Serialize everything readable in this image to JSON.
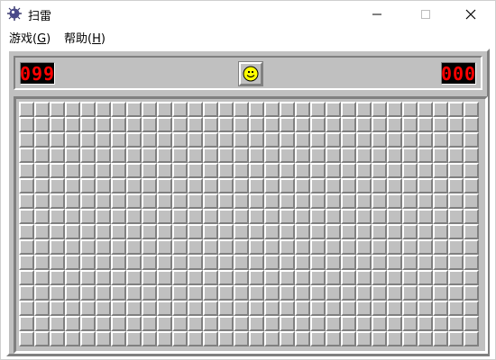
{
  "window": {
    "title": "扫雷",
    "app_icon": "minesweeper-mine-icon",
    "controls": {
      "minimize_icon": "minimize-icon",
      "maximize_icon": "maximize-icon",
      "close_icon": "close-icon"
    }
  },
  "menu": {
    "items": [
      {
        "label": "游戏(",
        "accelerator": "G",
        "suffix": ")"
      },
      {
        "label": "帮助(",
        "accelerator": "H",
        "suffix": ")"
      }
    ]
  },
  "game": {
    "mines_remaining": "099",
    "timer": "000",
    "face_icon": "smiley-face-icon",
    "board": {
      "columns": 30,
      "rows": 16,
      "state": "all-covered"
    }
  },
  "colors": {
    "panel_gray": "#c0c0c0",
    "shadow_gray": "#808080",
    "highlight": "#ffffff",
    "led_red": "#ff0000",
    "led_bg": "#000000",
    "face_yellow": "#ffff00"
  }
}
